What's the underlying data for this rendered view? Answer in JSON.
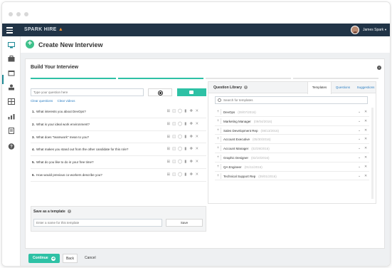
{
  "brand": {
    "name": "SPARK HIRE",
    "accent": "#2ec1a5",
    "nav_bg": "#213447"
  },
  "user": {
    "name": "James Spark"
  },
  "page": {
    "title": "Create New Interview"
  },
  "builder": {
    "title": "Build Your Interview",
    "question_input_placeholder": "Type your question here",
    "clear_questions": "Clear questions",
    "clear_videos": "Clear videos",
    "questions": [
      {
        "num": "1.",
        "text": "What interests you about DevOps?"
      },
      {
        "num": "2.",
        "text": "What is your ideal work environment?"
      },
      {
        "num": "3.",
        "text": "What does \"teamwork\" mean to you?"
      },
      {
        "num": "4.",
        "text": "What makes you stand out from the other candidate for this role?"
      },
      {
        "num": "5.",
        "text": "What do you like to do in your free time?"
      },
      {
        "num": "6.",
        "text": "How would previous co-workers describe you?"
      }
    ]
  },
  "template": {
    "title": "Save as a template",
    "input_placeholder": "Enter a name for this template",
    "save_label": "Save"
  },
  "library": {
    "title": "Question Library",
    "tabs": [
      "Templates",
      "Questions",
      "Suggestions"
    ],
    "active_tab": "Templates",
    "search_placeholder": "Search for templates",
    "items": [
      {
        "name": "DevOps",
        "date": "(09/07/2016)"
      },
      {
        "name": "Marketing Manager",
        "date": "(09/04/2016)"
      },
      {
        "name": "Sales Development Rep",
        "date": "(08/13/2016)"
      },
      {
        "name": "Account Executive",
        "date": "(05/30/2016)"
      },
      {
        "name": "Account Manager",
        "date": "(02/29/2016)"
      },
      {
        "name": "Graphic Designer",
        "date": "(02/10/2016)"
      },
      {
        "name": "QA Engineer",
        "date": "(01/11/2016)"
      },
      {
        "name": "Technical Support Rep",
        "date": "(09/01/2016)"
      }
    ]
  },
  "footer": {
    "continue_label": "Continue",
    "back_label": "Back",
    "cancel_label": "Cancel"
  },
  "icons": {
    "actions": [
      "import-icon",
      "video-library-icon",
      "record-video-icon",
      "camera-icon",
      "move-icon",
      "delete-icon"
    ]
  }
}
